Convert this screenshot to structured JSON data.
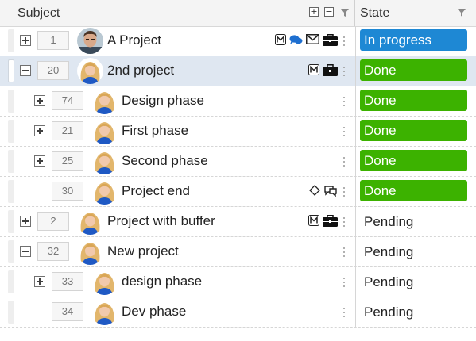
{
  "header": {
    "subject_label": "Subject",
    "state_label": "State",
    "expand_all_symbol": "+",
    "collapse_all_symbol": "−"
  },
  "colors": {
    "in_progress": "#1e88d4",
    "done": "#3cb200",
    "selected_row": "#dfe7f1"
  },
  "rows": [
    {
      "id": "1",
      "name": "A Project",
      "level": 0,
      "expander": "plus",
      "avatar": "man",
      "icons": [
        "milestone-m-icon",
        "chat-icon",
        "mail-icon",
        "briefcase-icon"
      ],
      "state": "In progress",
      "state_style": "in_progress"
    },
    {
      "id": "20",
      "name": "2nd project",
      "level": 0,
      "expander": "minus",
      "avatar": "woman",
      "icons": [
        "milestone-m-icon",
        "briefcase-icon"
      ],
      "state": "Done",
      "state_style": "done",
      "selected": true
    },
    {
      "id": "74",
      "name": "Design phase",
      "level": 1,
      "expander": "plus",
      "avatar": "woman",
      "icons": [],
      "state": "Done",
      "state_style": "done"
    },
    {
      "id": "21",
      "name": "First phase",
      "level": 1,
      "expander": "plus",
      "avatar": "woman",
      "icons": [],
      "state": "Done",
      "state_style": "done"
    },
    {
      "id": "25",
      "name": "Second phase",
      "level": 1,
      "expander": "plus",
      "avatar": "woman",
      "icons": [],
      "state": "Done",
      "state_style": "done"
    },
    {
      "id": "30",
      "name": "Project end",
      "level": 1,
      "expander": "none",
      "avatar": "woman",
      "icons": [
        "diamond-milestone-icon",
        "comments-icon"
      ],
      "state": "Done",
      "state_style": "done"
    },
    {
      "id": "2",
      "name": "Project with buffer",
      "level": 0,
      "expander": "plus",
      "avatar": "woman",
      "icons": [
        "milestone-m-icon",
        "briefcase-icon"
      ],
      "state": "Pending",
      "state_style": "plain"
    },
    {
      "id": "32",
      "name": "New project",
      "level": 0,
      "expander": "minus",
      "avatar": "woman",
      "icons": [],
      "state": "Pending",
      "state_style": "plain"
    },
    {
      "id": "33",
      "name": "design phase",
      "level": 1,
      "expander": "plus",
      "avatar": "woman",
      "icons": [],
      "state": "Pending",
      "state_style": "plain"
    },
    {
      "id": "34",
      "name": "Dev phase",
      "level": 1,
      "expander": "none",
      "avatar": "woman",
      "icons": [],
      "state": "Pending",
      "state_style": "plain"
    }
  ]
}
